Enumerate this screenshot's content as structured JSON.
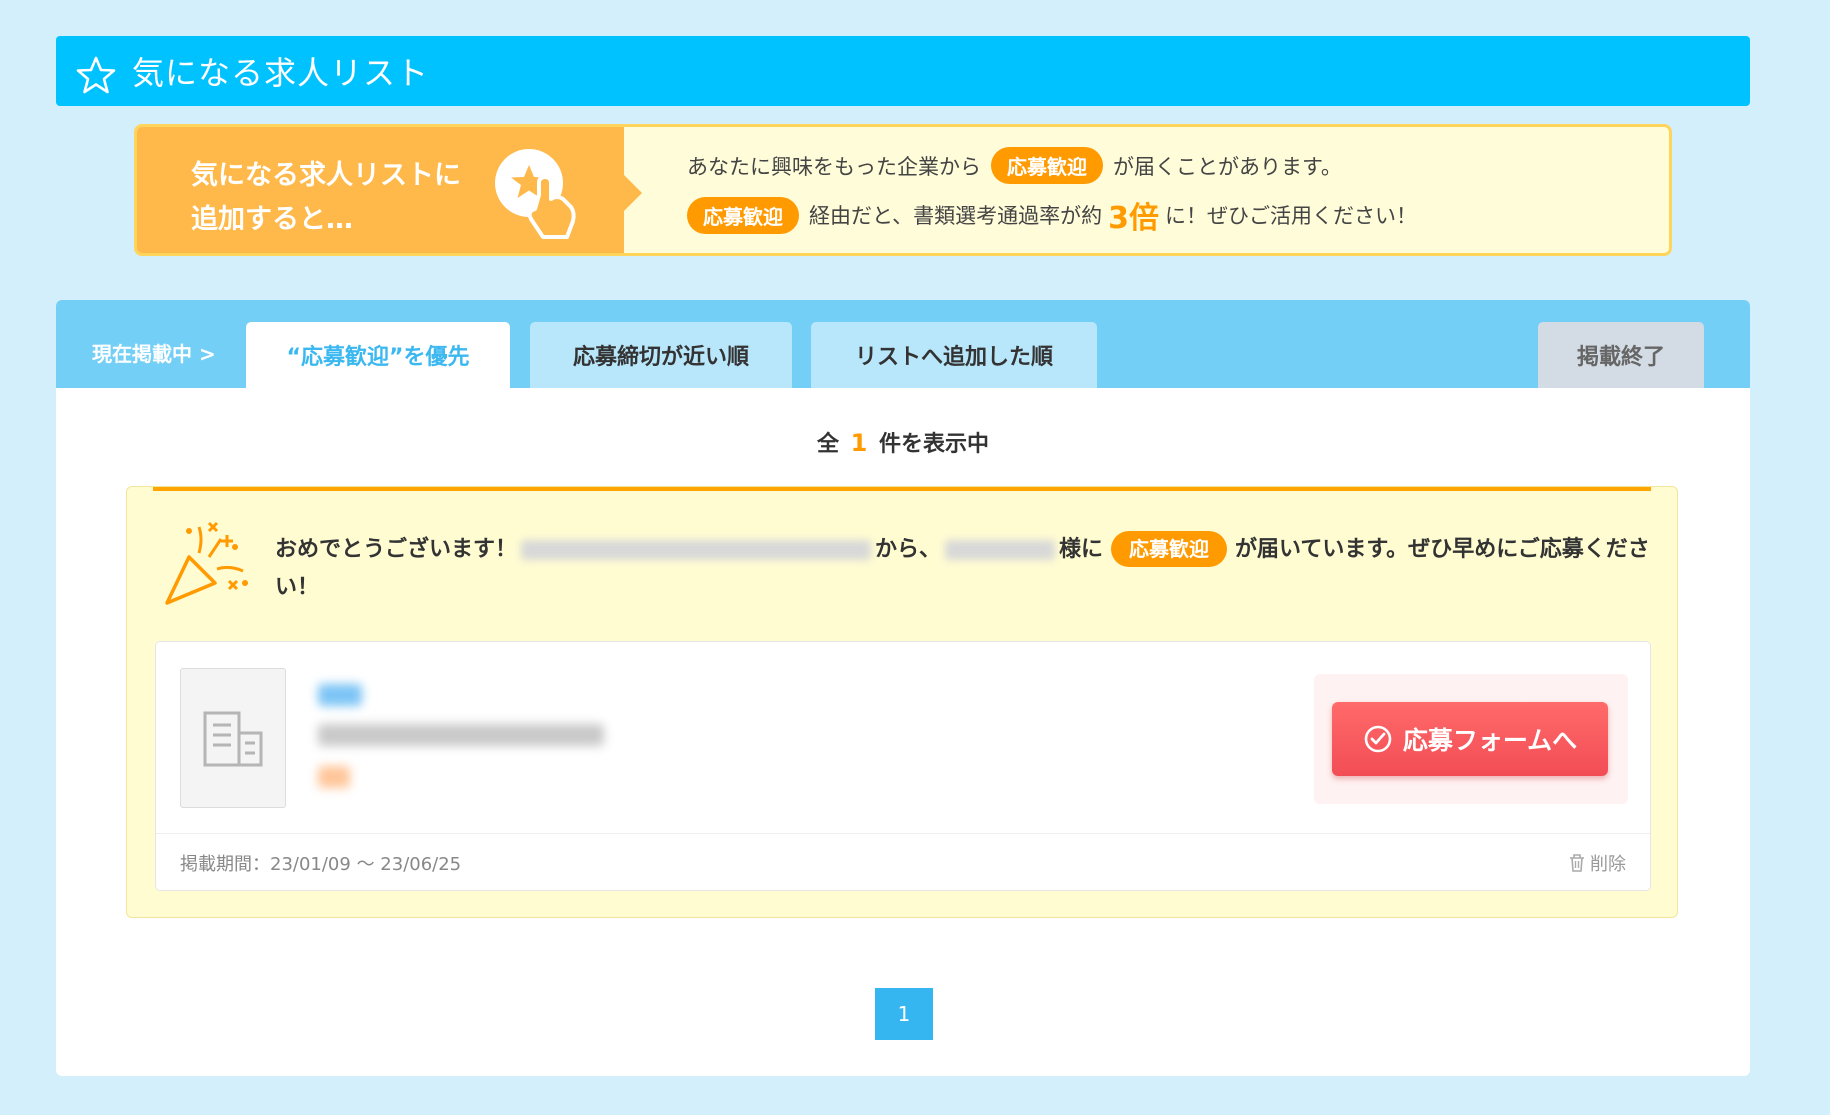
{
  "header": {
    "title": "気になる求人リスト",
    "icon": "star-icon"
  },
  "promo": {
    "left_line1": "気になる求人リストに",
    "left_line2": "追加すると…",
    "row1_text": "あなたに興味をもった企業から",
    "badge": "応募歓迎",
    "row1_suffix": "が届くことがあります。",
    "row2_text": "経由だと、書類選考通過率が約",
    "multiplier": "3倍",
    "row2_suffix": "に！ぜひご活用ください！",
    "accent": "#ff9a00"
  },
  "tabs": {
    "prefix": "現在掲載中 >",
    "items": [
      {
        "label": "“応募歓迎”を優先",
        "active": true
      },
      {
        "label": "応募締切が近い順",
        "active": false
      },
      {
        "label": "リストへ追加した順",
        "active": false
      },
      {
        "label": "掲載終了",
        "active": false
      }
    ]
  },
  "count": {
    "prefix": "全",
    "value": "1",
    "suffix": "件を表示中"
  },
  "notice": {
    "part1": "おめでとうございます！",
    "part2": "から、",
    "part3": "様に",
    "badge": "応募歓迎",
    "part4": "が届いています。ぜひ早めにご応募ください！"
  },
  "job": {
    "apply_label": "応募フォームへ",
    "period": "掲載期間：23/01/09 ～ 23/06/25",
    "delete_label": "削除"
  },
  "pagination": {
    "current": "1"
  }
}
